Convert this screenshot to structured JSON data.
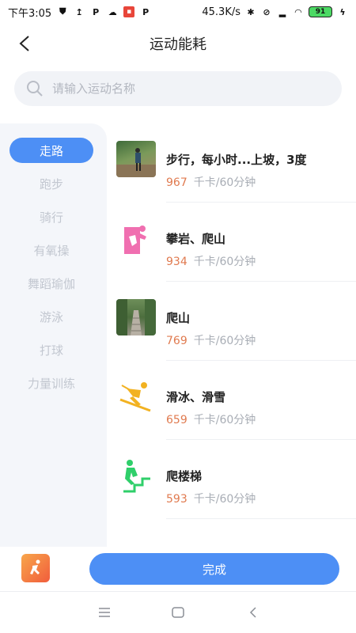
{
  "status_bar": {
    "time": "下午3:05",
    "net_speed": "45.3K/s",
    "battery": "91"
  },
  "header": {
    "title": "运动能耗"
  },
  "search": {
    "placeholder": "请输入运动名称"
  },
  "categories": [
    {
      "label": "走路",
      "active": true
    },
    {
      "label": "跑步"
    },
    {
      "label": "骑行"
    },
    {
      "label": "有氧操"
    },
    {
      "label": "舞蹈瑜伽"
    },
    {
      "label": "游泳"
    },
    {
      "label": "打球"
    },
    {
      "label": "力量训练"
    }
  ],
  "activities": [
    {
      "title": "步行，每小时...上坡，3度",
      "kcal": "967",
      "unit": "千卡/60分钟",
      "icon": "hiking-photo"
    },
    {
      "title": "攀岩、爬山",
      "kcal": "934",
      "unit": "千卡/60分钟",
      "icon": "rock-climbing-icon",
      "color": "#f06fb0"
    },
    {
      "title": "爬山",
      "kcal": "769",
      "unit": "千卡/60分钟",
      "icon": "mountain-stairs-photo"
    },
    {
      "title": "滑冰、滑雪",
      "kcal": "659",
      "unit": "千卡/60分钟",
      "icon": "skiing-icon",
      "color": "#f2b221"
    },
    {
      "title": "爬楼梯",
      "kcal": "593",
      "unit": "千卡/60分钟",
      "icon": "stairs-climbing-icon",
      "color": "#2fcf6a"
    }
  ],
  "action_bar": {
    "done_label": "完成"
  },
  "colors": {
    "accent": "#4d8ff5",
    "kcal": "#e07a4f"
  }
}
